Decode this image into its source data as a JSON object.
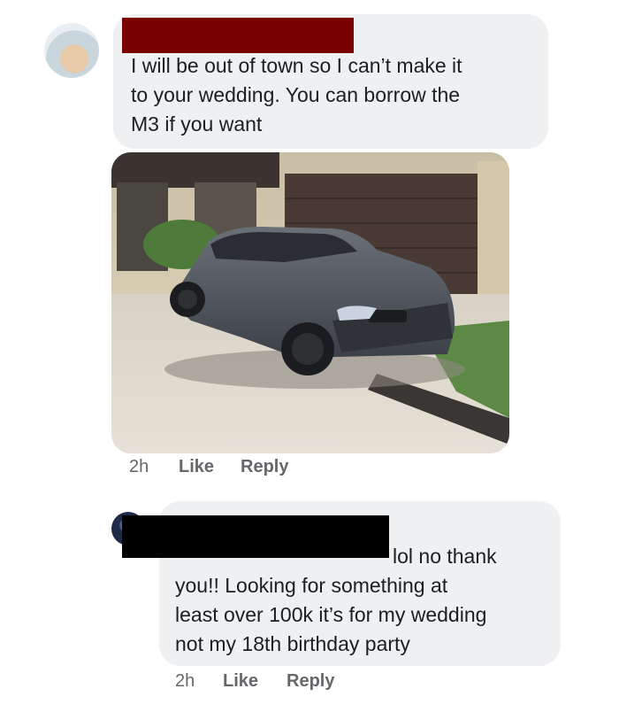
{
  "comment1": {
    "text_lines": [
      "I will be out of town so I can’t make it",
      "to your wedding. You can borrow the",
      "M3 if you want"
    ],
    "time": "2h",
    "like_label": "Like",
    "reply_label": "Reply"
  },
  "comment2": {
    "text_lines": [
      "lol no thank",
      "you!! Looking for something at",
      "least over 100k it’s for my wedding",
      "not my 18th birthday party"
    ],
    "time": "2h",
    "like_label": "Like",
    "reply_label": "Reply"
  },
  "colors": {
    "bubble": "#eff0f2",
    "meta_text": "#65676b",
    "redaction_red": "#7a0000",
    "redaction_black": "#000000"
  }
}
